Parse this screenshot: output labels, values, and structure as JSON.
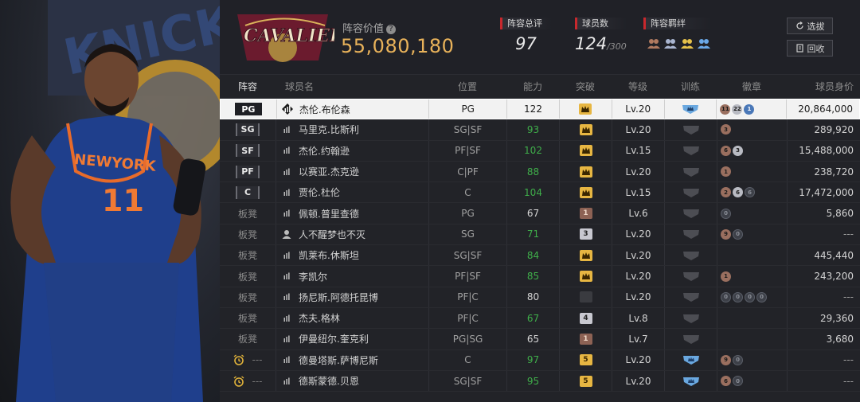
{
  "header": {
    "team_logo_text": "CAVALIERS",
    "value_label": "阵容价值",
    "value": "55,080,180",
    "overall_label": "阵容总评",
    "overall": "97",
    "count_label": "球员数",
    "count": "124",
    "count_max": "/300",
    "bond_label": "阵容羁绊",
    "select_button": "选拔",
    "recycle_button": "回收"
  },
  "columns": {
    "slot": "阵容",
    "name": "球员名",
    "pos": "位置",
    "ovr": "能力",
    "breakthrough": "突破",
    "level": "等级",
    "training": "训练",
    "badges": "徽章",
    "value": "球员身价"
  },
  "colors": {
    "accent_gold": "#e8b25a",
    "ability_green": "#3fae4a",
    "label_red": "#c8282d"
  },
  "rows": [
    {
      "slot": "PG",
      "name": "杰伦.布伦森",
      "pos": "PG",
      "ovr": "122",
      "ovr_color": "white",
      "brk": "",
      "brk_type": "gold",
      "level": "Lv.20",
      "train": "blue",
      "badges": [
        {
          "t": "bronze",
          "n": "11"
        },
        {
          "t": "silver",
          "n": "22"
        },
        {
          "t": "blue",
          "n": "1"
        }
      ],
      "value": "20,864,000",
      "icon": "bars"
    },
    {
      "slot": "SG",
      "name": "马里克.比斯利",
      "pos": "SG|SF",
      "ovr": "93",
      "ovr_color": "green",
      "brk": "",
      "brk_type": "gold",
      "level": "Lv.20",
      "train": "gray",
      "badges": [
        {
          "t": "bronze",
          "n": "3"
        }
      ],
      "value": "289,920",
      "icon": "bars"
    },
    {
      "slot": "SF",
      "name": "杰伦.约翰逊",
      "pos": "PF|SF",
      "ovr": "102",
      "ovr_color": "green",
      "brk": "",
      "brk_type": "gold",
      "level": "Lv.15",
      "train": "gray",
      "badges": [
        {
          "t": "bronze",
          "n": "6"
        },
        {
          "t": "silver",
          "n": "3"
        }
      ],
      "value": "15,488,000",
      "icon": "bars"
    },
    {
      "slot": "PF",
      "name": "以赛亚.杰克逊",
      "pos": "C|PF",
      "ovr": "88",
      "ovr_color": "green",
      "brk": "",
      "brk_type": "gold",
      "level": "Lv.20",
      "train": "gray",
      "badges": [
        {
          "t": "bronze",
          "n": "1"
        }
      ],
      "value": "238,720",
      "icon": "bars"
    },
    {
      "slot": "C",
      "name": "贾伦.杜伦",
      "pos": "C",
      "ovr": "104",
      "ovr_color": "green",
      "brk": "",
      "brk_type": "gold",
      "level": "Lv.15",
      "train": "gray",
      "badges": [
        {
          "t": "bronze",
          "n": "2"
        },
        {
          "t": "silver",
          "n": "6"
        },
        {
          "t": "dark",
          "n": "6"
        }
      ],
      "value": "17,472,000",
      "icon": "bars"
    },
    {
      "slot": "板凳",
      "name": "佩顿.普里查德",
      "pos": "PG",
      "ovr": "67",
      "ovr_color": "white",
      "brk": "1",
      "brk_type": "bronze",
      "level": "Lv.6",
      "train": "gray",
      "badges": [
        {
          "t": "dark",
          "n": "0"
        }
      ],
      "value": "5,860",
      "icon": "bars"
    },
    {
      "slot": "板凳",
      "name": "人不醒梦也不灭",
      "pos": "SG",
      "ovr": "71",
      "ovr_color": "green",
      "brk": "3",
      "brk_type": "silver",
      "level": "Lv.20",
      "train": "gray",
      "badges": [
        {
          "t": "bronze",
          "n": "9"
        },
        {
          "t": "dark",
          "n": "0"
        }
      ],
      "value": "---",
      "icon": "person"
    },
    {
      "slot": "板凳",
      "name": "凯莱布.休斯坦",
      "pos": "SG|SF",
      "ovr": "84",
      "ovr_color": "green",
      "brk": "",
      "brk_type": "gold",
      "level": "Lv.20",
      "train": "gray",
      "badges": [],
      "value": "445,440",
      "icon": "bars"
    },
    {
      "slot": "板凳",
      "name": "李凯尔",
      "pos": "PF|SF",
      "ovr": "85",
      "ovr_color": "green",
      "brk": "",
      "brk_type": "gold",
      "level": "Lv.20",
      "train": "gray",
      "badges": [
        {
          "t": "bronze",
          "n": "1"
        }
      ],
      "value": "243,200",
      "icon": "bars"
    },
    {
      "slot": "板凳",
      "name": "扬尼斯.阿德托昆博",
      "pos": "PF|C",
      "ovr": "80",
      "ovr_color": "white",
      "brk": "",
      "brk_type": "none",
      "level": "Lv.20",
      "train": "gray",
      "badges": [
        {
          "t": "dark",
          "n": "0"
        },
        {
          "t": "dark",
          "n": "0"
        },
        {
          "t": "dark",
          "n": "0"
        },
        {
          "t": "dark",
          "n": "0"
        }
      ],
      "value": "---",
      "icon": "bars"
    },
    {
      "slot": "板凳",
      "name": "杰夫.格林",
      "pos": "PF|C",
      "ovr": "67",
      "ovr_color": "green",
      "brk": "4",
      "brk_type": "silver",
      "level": "Lv.8",
      "train": "gray",
      "badges": [],
      "value": "29,360",
      "icon": "bars"
    },
    {
      "slot": "板凳",
      "name": "伊曼纽尔.奎克利",
      "pos": "PG|SG",
      "ovr": "65",
      "ovr_color": "white",
      "brk": "1",
      "brk_type": "bronze",
      "level": "Lv.7",
      "train": "gray",
      "badges": [],
      "value": "3,680",
      "icon": "bars"
    },
    {
      "slot": "---",
      "name": "德曼塔斯.萨博尼斯",
      "pos": "C",
      "ovr": "97",
      "ovr_color": "green",
      "brk": "5",
      "brk_type": "gold",
      "level": "Lv.20",
      "train": "blue",
      "badges": [
        {
          "t": "bronze",
          "n": "9"
        },
        {
          "t": "dark",
          "n": "0"
        }
      ],
      "value": "---",
      "icon": "bars",
      "alarm": true
    },
    {
      "slot": "---",
      "name": "德斯蒙德.贝恩",
      "pos": "SG|SF",
      "ovr": "95",
      "ovr_color": "green",
      "brk": "5",
      "brk_type": "gold",
      "level": "Lv.20",
      "train": "blue",
      "badges": [
        {
          "t": "bronze",
          "n": "6"
        },
        {
          "t": "dark",
          "n": "0"
        }
      ],
      "value": "---",
      "icon": "bars",
      "alarm": true
    }
  ]
}
